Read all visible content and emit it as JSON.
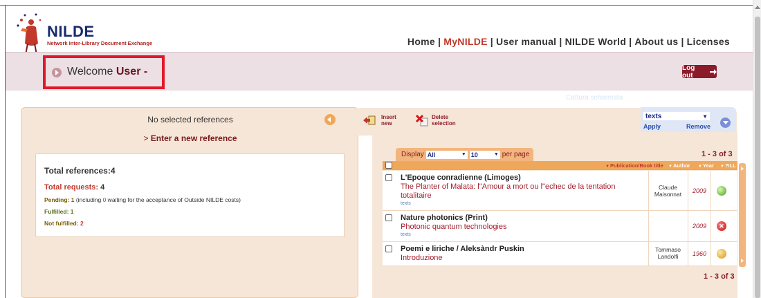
{
  "header": {
    "logo_title": "NILDE",
    "logo_subtitle": "Network Inter-Library Document Exchange",
    "nav": [
      {
        "label": "Home",
        "active": false
      },
      {
        "label": "MyNILDE",
        "active": true
      },
      {
        "label": "User manual",
        "active": false
      },
      {
        "label": "NILDE World",
        "active": false
      },
      {
        "label": "About us",
        "active": false
      },
      {
        "label": "Licenses",
        "active": false
      }
    ],
    "separator": "|"
  },
  "welcome": {
    "greeting": "Welcome",
    "user": "User -",
    "logout_label": "Log out",
    "ghost_text": "Cattura schermata"
  },
  "left_panel": {
    "no_selection": "No selected references",
    "enter_prefix": "> ",
    "enter_link": "Enter a new reference",
    "stats": {
      "total_references_label": "Total references:",
      "total_references": "4",
      "total_requests_label": "Total requests: ",
      "total_requests": "4",
      "pending_label": "Pending: ",
      "pending": "1",
      "pending_note_pre": " (including ",
      "pending_outside": "0",
      "pending_note_post": " waiting for the acceptance of Outside NILDE costs)",
      "fulfilled_label": "Fulfilled: ",
      "fulfilled": "1",
      "not_fulfilled_label": "Not fulfilled: ",
      "not_fulfilled": "2"
    }
  },
  "toolbar": {
    "insert_line1": "Insert",
    "insert_line2": "new",
    "delete_line1": "Delete",
    "delete_line2": "selection",
    "filter_value": "texts",
    "apply_label": "Apply",
    "remove_label": "Remove"
  },
  "list": {
    "display_label": "Display",
    "display_value": "All",
    "per_page_value": "10",
    "per_page_label": "per page",
    "pager": "1 - 3 of 3",
    "columns": {
      "publication": "Publication/Book title",
      "author": "Author",
      "year": "Year",
      "ill": "?ILL"
    },
    "rows": [
      {
        "title": "L'Epoque conradienne (Limoges)",
        "subtitle": "The Planter of Malata: l\"Amour a mort ou l\"echec de la tentation totalitaire",
        "tag": "texts",
        "author": "Claude Maisonnat",
        "year": "2009",
        "status": "green"
      },
      {
        "title": "Nature photonics (Print)",
        "subtitle": "Photonic quantum technologies",
        "tag": "texts",
        "author": "",
        "year": "2009",
        "status": "red"
      },
      {
        "title": "Poemi e liriche / Aleksàndr Puskin",
        "subtitle": "Introduzione",
        "tag": "",
        "author": "Tommaso Landolfi",
        "year": "1960",
        "status": "amber"
      }
    ]
  },
  "colors": {
    "brand_red": "#8b1a2b",
    "band": "#ece0e4",
    "panel": "#f6e6d7",
    "accent_orange": "#efa75a",
    "highlight": "#e2182a"
  }
}
